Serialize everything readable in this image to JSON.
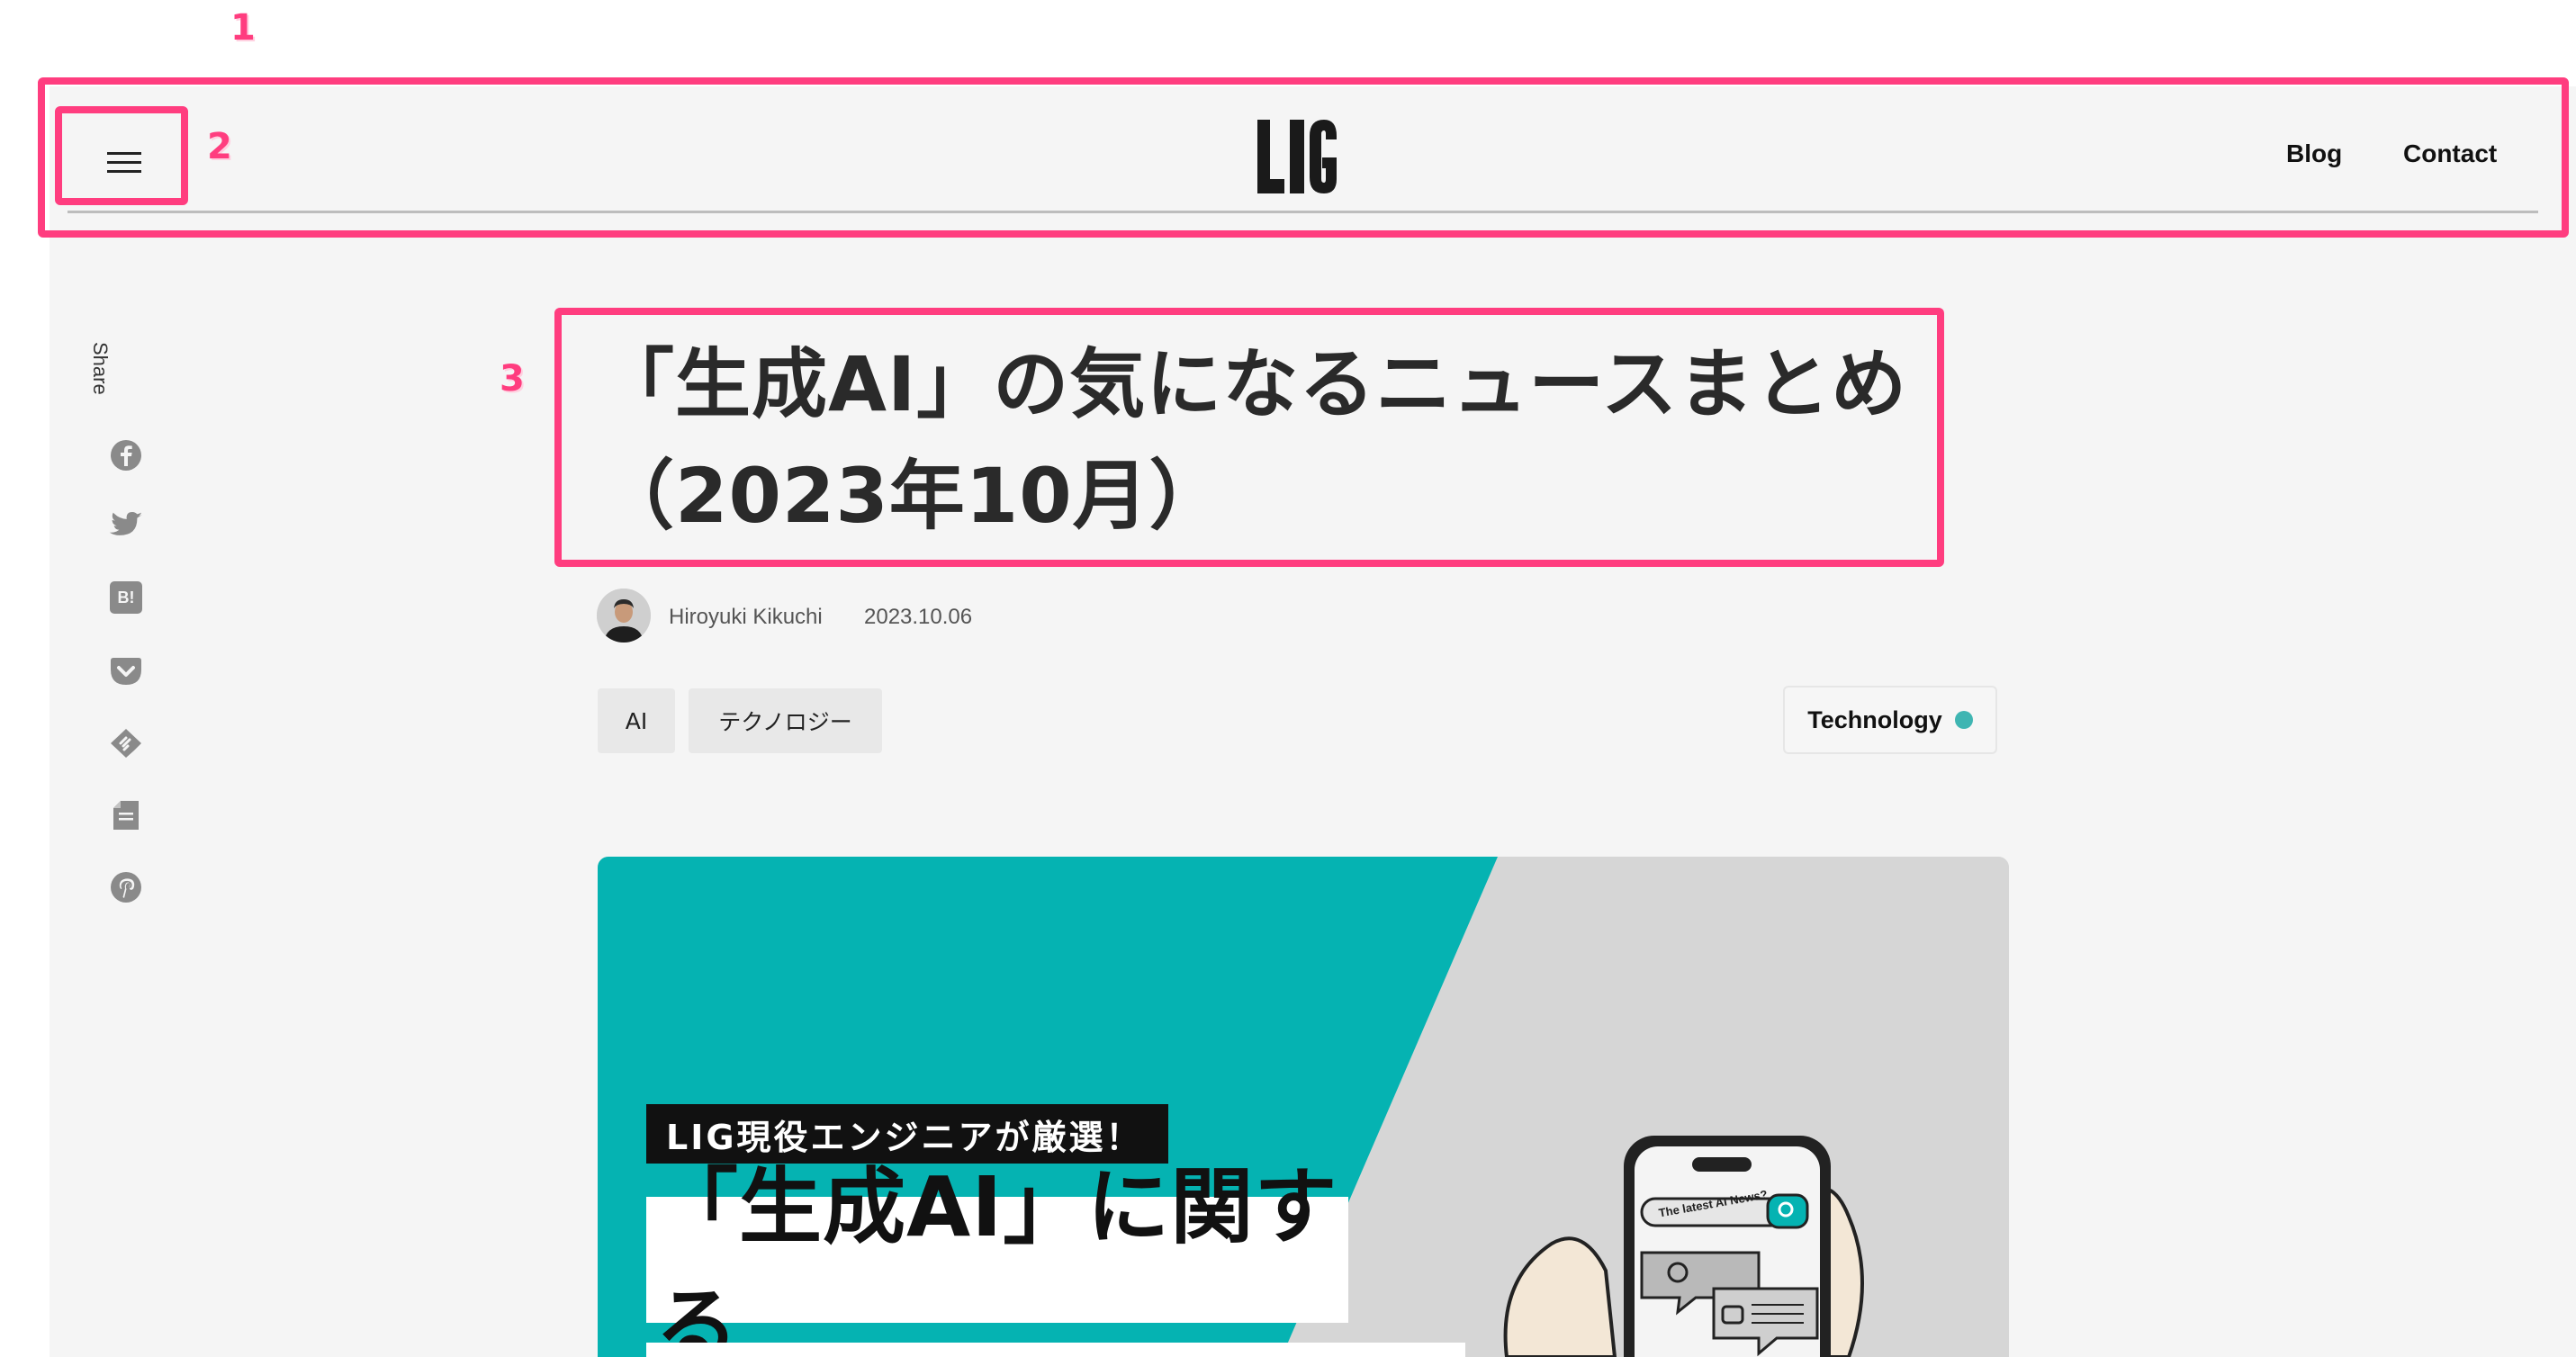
{
  "annotations": [
    "1",
    "2",
    "3"
  ],
  "header": {
    "logo": "LIG",
    "nav": [
      {
        "label": "Blog"
      },
      {
        "label": "Contact"
      }
    ]
  },
  "share": {
    "label": "Share",
    "icons": [
      "facebook-icon",
      "twitter-icon",
      "hatena-bookmark-icon",
      "pocket-icon",
      "feedly-icon",
      "note-icon",
      "pinterest-icon"
    ],
    "hatena_text": "B!"
  },
  "article": {
    "title_line1": "「生成AI」の気になるニュースまとめ",
    "title_line2": "（2023年10月）",
    "author": "Hiroyuki Kikuchi",
    "date": "2023.10.06",
    "tags": [
      "AI",
      "テクノロジー"
    ],
    "category": "Technology"
  },
  "hero": {
    "badge": "LIG現役エンジニアが厳選！",
    "headline": "「生成AI」に関する",
    "phone_search": "The latest AI News?"
  },
  "colors": {
    "accent": "#ff3d7f",
    "hero_teal": "#05b3b2",
    "category_dot": "#3fb5b2"
  }
}
